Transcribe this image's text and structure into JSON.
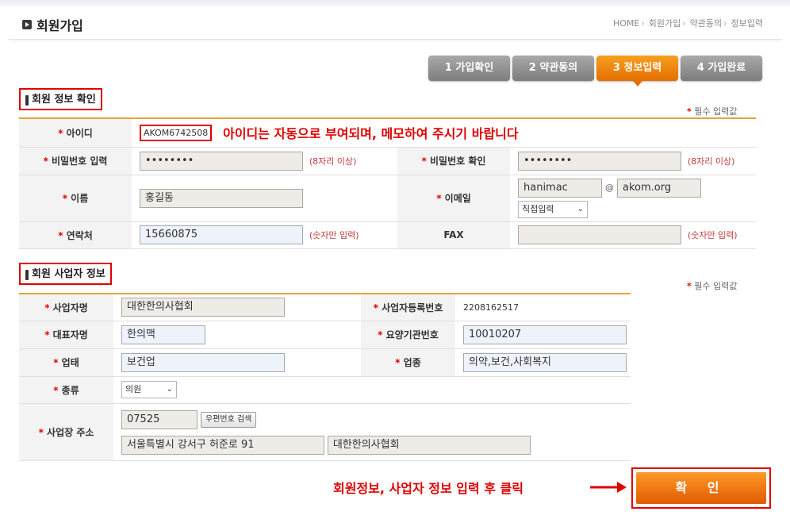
{
  "header": {
    "title": "회원가입",
    "breadcrumb": [
      "HOME",
      "회원가입",
      "약관동의",
      "정보입력"
    ]
  },
  "steps": [
    {
      "label": "1 가입확인",
      "active": false
    },
    {
      "label": "2 약관동의",
      "active": false
    },
    {
      "label": "3 정보입력",
      "active": true
    },
    {
      "label": "4 가입완료",
      "active": false
    }
  ],
  "required_note": "필수 입력값",
  "member": {
    "section_title": "회원 정보 확인",
    "id_label": "아이디",
    "id_value": "AKOM6742508",
    "id_notice": "아이디는 자동으로 부여되며, 메모하여 주시기 바랍니다",
    "password_label": "비밀번호 입력",
    "password_value": "••••••••",
    "password_hint": "(8자리 이상)",
    "password_confirm_label": "비밀번호 확인",
    "password_confirm_value": "••••••••",
    "password_confirm_hint": "(8자리 이상)",
    "name_label": "이름",
    "name_value": "홍길동",
    "email_label": "이메일",
    "email_user": "hanimac",
    "email_at": "@",
    "email_domain": "akom.org",
    "email_select": "직접입력",
    "phone_label": "연락처",
    "phone_value": "15660875",
    "phone_hint": "(숫자만 입력)",
    "fax_label": "FAX",
    "fax_value": "",
    "fax_hint": "(숫자만 입력)"
  },
  "business": {
    "section_title": "회원 사업자 정보",
    "biz_name_label": "사업자명",
    "biz_name_value": "대한한의사협회",
    "biz_reg_label": "사업자등록번호",
    "biz_reg_value": "2208162517",
    "rep_label": "대표자명",
    "rep_value": "한의맥",
    "care_label": "요양기관번호",
    "care_value": "10010207",
    "type_label": "업태",
    "type_value": "보건업",
    "item_label": "업종",
    "item_value": "의약,보건,사회복지",
    "kind_label": "종류",
    "kind_value": "의원",
    "address_label": "사업장 주소",
    "zipcode": "07525",
    "zip_search_button": "우편번호 검색",
    "address1": "서울특별시 강서구 허준로 91",
    "address2": "대한한의사협회"
  },
  "footer": {
    "notice": "회원정보, 사업자 정보 입력 후 클릭",
    "confirm_button": "확 인"
  },
  "colors": {
    "accent": "#e56e00",
    "highlight_red": "#e00000"
  }
}
